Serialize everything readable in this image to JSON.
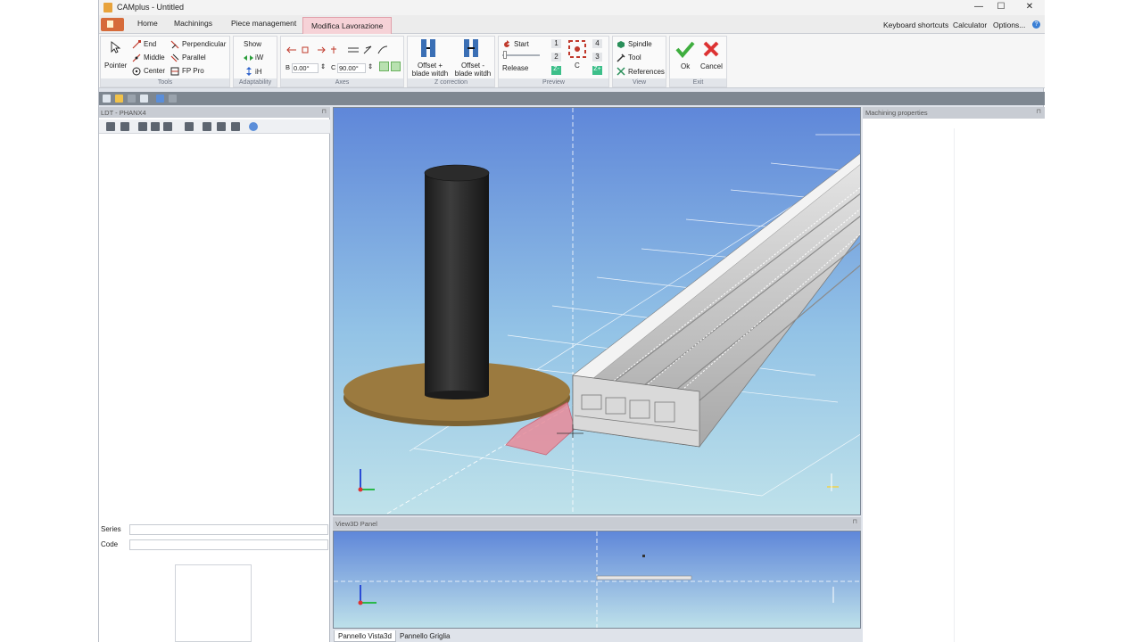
{
  "window": {
    "title": "CAMplus - Untitled",
    "controls": {
      "minimize": "—",
      "maximize": "☐",
      "close": "✕"
    }
  },
  "ribbon_tabs": [
    {
      "label": "Home"
    },
    {
      "label": "Machinings"
    },
    {
      "label": "Piece management"
    },
    {
      "label": "Modifica Lavorazione",
      "active": true
    }
  ],
  "ribbon_links": {
    "keyboard_shortcuts": "Keyboard shortcuts",
    "calculator": "Calculator",
    "options": "Options...",
    "help": "?"
  },
  "groups": {
    "tools": {
      "label": "Tools",
      "pointer": "Pointer",
      "end": "End",
      "middle": "Middle",
      "center": "Center",
      "perpendicular": "Perpendicular",
      "parallel": "Parallel",
      "fp_pro": "FP Pro"
    },
    "adaptability": {
      "label": "Adaptability",
      "show": "Show",
      "iw": "iW",
      "ih": "iH"
    },
    "axes": {
      "label": "Axes",
      "b_label": "B",
      "b_value": "0.00°",
      "c_label": "C",
      "c_value": "90.00°"
    },
    "z_correction": {
      "label": "Z correction",
      "offset_plus_line1": "Offset +",
      "offset_plus_line2": "blade witdh",
      "offset_minus_line1": "Offset -",
      "offset_minus_line2": "blade witdh"
    },
    "preview": {
      "label": "Preview",
      "start": "Start",
      "release": "Release",
      "n1": "1",
      "n2": "2",
      "n3": "3",
      "n4": "4",
      "c_label": "C",
      "z_minus": "Z-",
      "z_plus": "Z+"
    },
    "view": {
      "label": "View",
      "spindle": "Spindle",
      "tool": "Tool",
      "references": "References"
    },
    "exit": {
      "label": "Exit",
      "ok": "Ok",
      "cancel": "Cancel"
    }
  },
  "left_panel": {
    "title": "LDT - PHANX4",
    "series_label": "Series",
    "code_label": "Code",
    "series_value": "",
    "code_value": ""
  },
  "bottom_panel": {
    "title": "View3D Panel",
    "tabs": [
      {
        "label": "Pannello Vista3d",
        "active": true
      },
      {
        "label": "Pannello Griglia"
      }
    ]
  },
  "right_panel": {
    "title": "Machining properties"
  },
  "colors": {
    "active_tab": "#f6d2d7",
    "sky_top": "#5d86d8",
    "sky_bottom": "#b9dde8",
    "disc": "#9b7a3f",
    "cylinder": "#2a2a2a",
    "profile": "#c9c9c9",
    "cut_region": "#e88b9a"
  },
  "icons": [
    "pointer-icon",
    "end-icon",
    "middle-icon",
    "center-icon",
    "perpendicular-icon",
    "parallel-icon",
    "fp-pro-icon",
    "ok-check-icon",
    "cancel-x-icon",
    "spindle-icon",
    "tool-icon",
    "references-icon",
    "start-icon"
  ]
}
